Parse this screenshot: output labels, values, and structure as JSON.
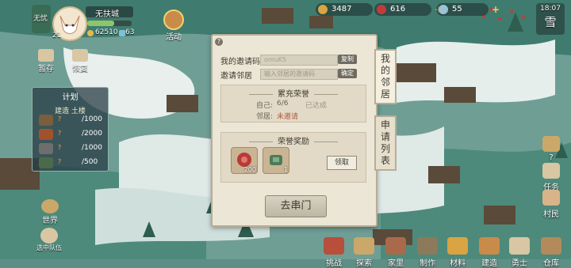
{
  "player": {
    "name": "无扶城",
    "level": "21",
    "coins": "62510",
    "gems": "63",
    "badge": "无忧"
  },
  "top_left_buttons": {
    "temp": "暂存",
    "recover": "恢复",
    "activity": "活动"
  },
  "resources": {
    "copper": "3487",
    "meat": "616",
    "silver": "55"
  },
  "weather": {
    "time": "18:07",
    "label": "雪"
  },
  "plan": {
    "title": "计划",
    "subtitle": "建造 土楼",
    "items": [
      {
        "used": "?",
        "value": "/1000",
        "fraction": 0.9,
        "color": "#7a5e3e"
      },
      {
        "used": "?",
        "value": "/2000",
        "fraction": 0.6,
        "color": "#a0522d"
      },
      {
        "used": "?",
        "value": "/1000",
        "fraction": 0.8,
        "color": "#6e6e6e"
      },
      {
        "used": "?",
        "value": "/500",
        "fraction": 0.7,
        "color": "#4a6a4a"
      }
    ]
  },
  "world_label": "世界",
  "squad_label": "选中队伍",
  "dialog": {
    "help": "?",
    "invite_code_label": "我的邀请码",
    "invite_code_value": "omuK5",
    "copy_btn": "复制",
    "invite_label": "邀请邻居",
    "invite_placeholder": "输入邻居的邀请码",
    "confirm_btn": "确定",
    "honor_title": "累充荣誉",
    "self_label": "自己:",
    "self_value": "6/6",
    "self_status": "已达成",
    "neighbor_label": "邻居:",
    "neighbor_status": "未邀请",
    "reward_title": "荣誉奖励",
    "reward_counts": [
      "200",
      "1"
    ],
    "claim_btn": "领取",
    "close_btn": "去串门"
  },
  "side_tabs": {
    "my_neighbors": "我的邻居",
    "apply_list": "申请列表"
  },
  "bottom_menu": [
    "挑战",
    "探索",
    "家里",
    "制作",
    "材料",
    "建造",
    "勇士",
    "仓库"
  ],
  "right_menu": [
    "?",
    "任务",
    "村民"
  ],
  "colors": {
    "accent": "#c98b4a",
    "invite_red": "#b25b3c",
    "panel_bg": "#ece6d6"
  }
}
